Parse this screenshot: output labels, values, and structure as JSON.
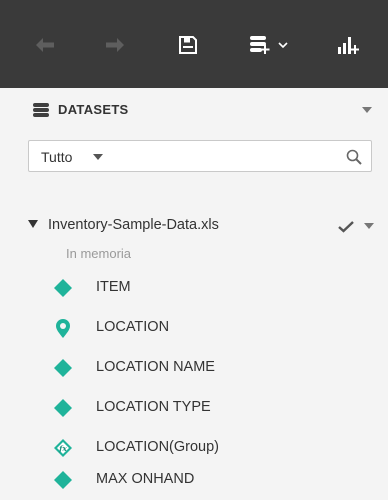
{
  "toolbar": {
    "buttons": [
      {
        "icon": "undo-arrow-icon",
        "enabled": false
      },
      {
        "icon": "redo-arrow-icon",
        "enabled": false
      },
      {
        "icon": "save-icon",
        "enabled": true
      },
      {
        "icon": "add-dataset-icon",
        "enabled": true
      },
      {
        "icon": "add-chart-icon",
        "enabled": true
      }
    ],
    "colors": {
      "background": "#3a3a3a",
      "icon_enabled": "#ffffff",
      "icon_disabled": "#5e5e5e"
    }
  },
  "panel": {
    "title": "DATASETS",
    "title_icon": "database-icon"
  },
  "filter": {
    "selected": "Tutto",
    "search_icon": "search-icon"
  },
  "dataset": {
    "name": "Inventory-Sample-Data.xls",
    "status": "In memoria",
    "loaded": true
  },
  "fields": [
    {
      "label": "ITEM",
      "icon": "dimension-icon"
    },
    {
      "label": "LOCATION",
      "icon": "geo-pin-icon"
    },
    {
      "label": "LOCATION NAME",
      "icon": "dimension-icon"
    },
    {
      "label": "LOCATION TYPE",
      "icon": "dimension-icon"
    },
    {
      "label": "LOCATION(Group)",
      "icon": "calculated-field-icon"
    },
    {
      "label": "MAX ONHAND",
      "icon": "dimension-icon"
    }
  ],
  "accent_color": "#1fb39a"
}
